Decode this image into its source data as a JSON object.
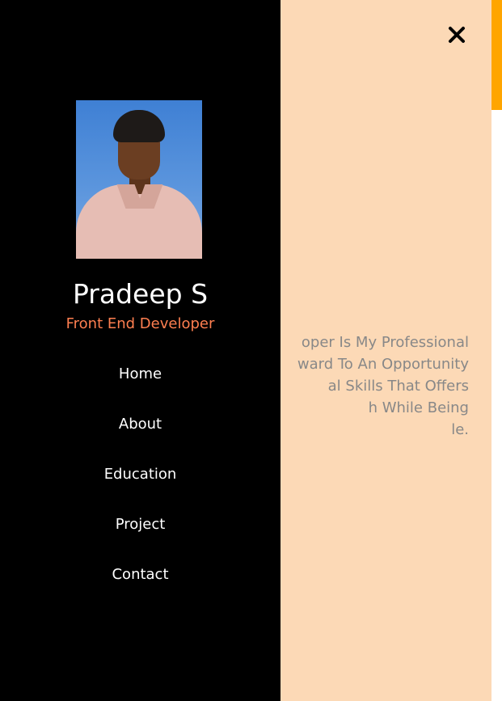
{
  "colors": {
    "page_background": "#fcd9b6",
    "sidebar_background": "#000000",
    "accent": "#ffa500",
    "role_text": "#ff7f50",
    "bio_text": "#888888",
    "scrollbar_thumb": "#ffa500"
  },
  "close_button": {
    "icon": "close-icon"
  },
  "hero": {
    "name_visible": "p S",
    "bio_lines": [
      "oper Is My Professional",
      "ward To An Opportunity",
      "al Skills That Offers",
      "h While Being",
      "le."
    ]
  },
  "sidebar": {
    "avatar": "profile-photo",
    "name": "Pradeep S",
    "role": "Front End Developer",
    "nav": [
      {
        "label": "Home"
      },
      {
        "label": "About"
      },
      {
        "label": "Education"
      },
      {
        "label": "Project"
      },
      {
        "label": "Contact"
      }
    ]
  }
}
